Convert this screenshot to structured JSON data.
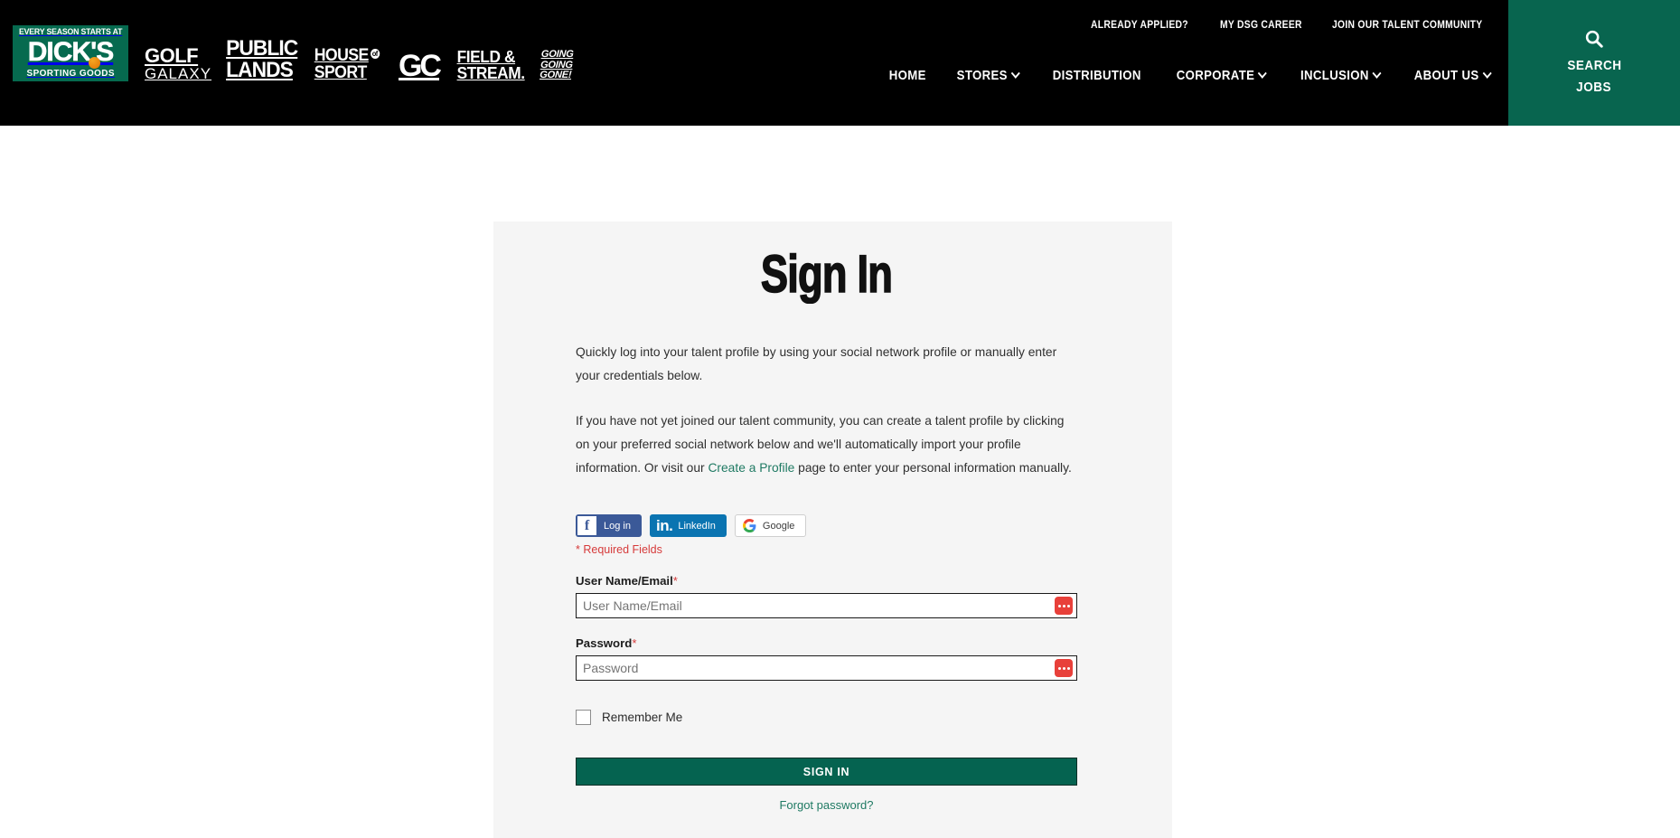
{
  "header": {
    "logo": {
      "tagline": "EVERY SEASON STARTS AT",
      "name": "DICK'S",
      "subtitle": "SPORTING GOODS"
    },
    "brands": [
      {
        "line1": "GOLF",
        "line2": "GALAXY"
      },
      {
        "line1": "PUBLIC",
        "line2": "LANDS"
      },
      {
        "line1": "HOUSE",
        "line2": "SPORT"
      },
      {
        "line1": "GC",
        "line2": ""
      },
      {
        "line1": "FIELD &",
        "line2": "STREAM."
      },
      {
        "line1": "GOING",
        "line2": "GOING",
        "line3": "GONE!"
      }
    ],
    "utility_links": [
      "ALREADY APPLIED?",
      "MY DSG CAREER",
      "JOIN OUR TALENT COMMUNITY"
    ],
    "main_nav": [
      {
        "label": "HOME",
        "caret": false
      },
      {
        "label": "STORES",
        "caret": true
      },
      {
        "label": "DISTRIBUTION",
        "caret": false
      },
      {
        "label": "CORPORATE",
        "caret": true
      },
      {
        "label": "INCLUSION",
        "caret": true
      },
      {
        "label": "ABOUT US",
        "caret": true
      }
    ],
    "search_panel": {
      "icon": "search-icon",
      "line1": "SEARCH",
      "line2": "JOBS"
    },
    "colors": {
      "bar_background": "#000000",
      "search_panel": "#08654f",
      "logo_green": "#066a4f"
    }
  },
  "main": {
    "title": "Sign In",
    "paragraph1": "Quickly log into your talent profile by using your social network profile or manually enter your credentials below.",
    "paragraph2_pre": "If you have not yet joined our talent community, you can create a talent profile by clicking on your preferred social network below and we'll automatically import your profile information. Or visit our ",
    "paragraph2_link": "Create a Profile",
    "paragraph2_post": " page to enter your personal information manually.",
    "social_buttons": [
      {
        "id": "facebook",
        "glyph": "f",
        "label": "Log in",
        "bg": "#3b5998"
      },
      {
        "id": "linkedin",
        "glyph": "in.",
        "label": "LinkedIn",
        "bg": "#0a74b1"
      },
      {
        "id": "google",
        "glyph": "G",
        "label": "Google",
        "bg": "#ffffff"
      }
    ],
    "required_note": "* Required Fields",
    "fields": [
      {
        "label": "User Name/Email",
        "required_mark": "*",
        "placeholder": "User Name/Email",
        "value": "",
        "manager_icon": "password-manager-icon"
      },
      {
        "label": "Password",
        "required_mark": "*",
        "placeholder": "Password",
        "value": "",
        "manager_icon": "password-manager-icon"
      }
    ],
    "remember_me": {
      "label": "Remember Me",
      "checked": false
    },
    "submit_label": "SIGN IN",
    "forgot_label": "Forgot password?",
    "colors": {
      "panel_background": "#f5f5f5",
      "link_green": "#1f7a63",
      "button_green": "#056350",
      "required_red": "#d63a3a",
      "password_manager_red": "#e8403a"
    }
  }
}
